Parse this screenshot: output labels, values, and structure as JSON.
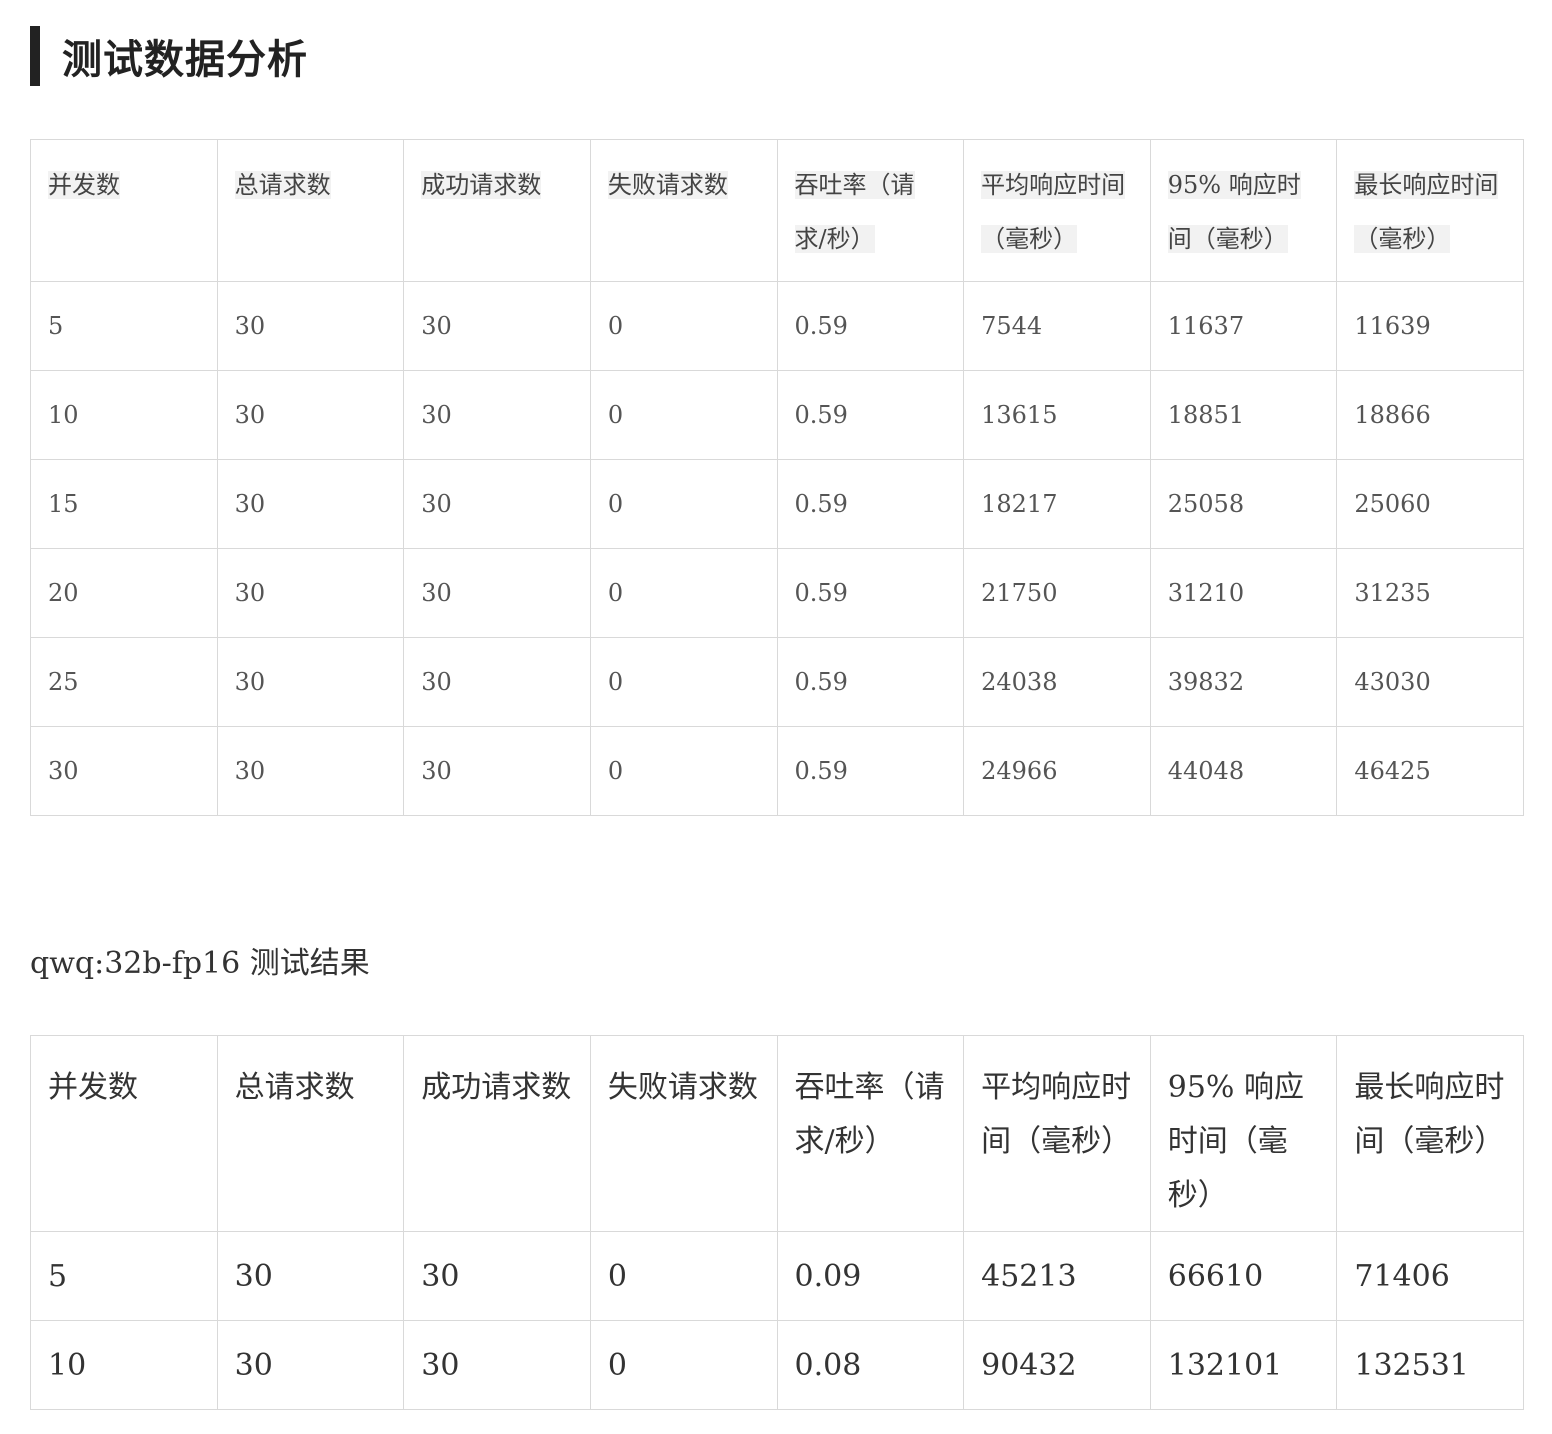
{
  "section": {
    "title": "测试数据分析"
  },
  "table1": {
    "headers": [
      "并发数",
      "总请求数",
      "成功请求数",
      "失败请求数",
      "吞吐率（请求/秒）",
      "平均响应时间（毫秒）",
      "95% 响应时间（毫秒）",
      "最长响应时间（毫秒）"
    ],
    "rows": [
      [
        "5",
        "30",
        "30",
        "0",
        "0.59",
        "7544",
        "11637",
        "11639"
      ],
      [
        "10",
        "30",
        "30",
        "0",
        "0.59",
        "13615",
        "18851",
        "18866"
      ],
      [
        "15",
        "30",
        "30",
        "0",
        "0.59",
        "18217",
        "25058",
        "25060"
      ],
      [
        "20",
        "30",
        "30",
        "0",
        "0.59",
        "21750",
        "31210",
        "31235"
      ],
      [
        "25",
        "30",
        "30",
        "0",
        "0.59",
        "24038",
        "39832",
        "43030"
      ],
      [
        "30",
        "30",
        "30",
        "0",
        "0.59",
        "24966",
        "44048",
        "46425"
      ]
    ]
  },
  "subtitle": "qwq:32b-fp16 测试结果",
  "table2": {
    "headers": [
      "并发数",
      "总请求数",
      "成功请求数",
      "失败请求数",
      "吞吐率（请求/秒）",
      "平均响应时间（毫秒）",
      "95% 响应时间（毫秒）",
      "最长响应时间（毫秒）"
    ],
    "rows": [
      [
        "5",
        "30",
        "30",
        "0",
        "0.09",
        "45213",
        "66610",
        "71406"
      ],
      [
        "10",
        "30",
        "30",
        "0",
        "0.08",
        "90432",
        "132101",
        "132531"
      ]
    ]
  }
}
